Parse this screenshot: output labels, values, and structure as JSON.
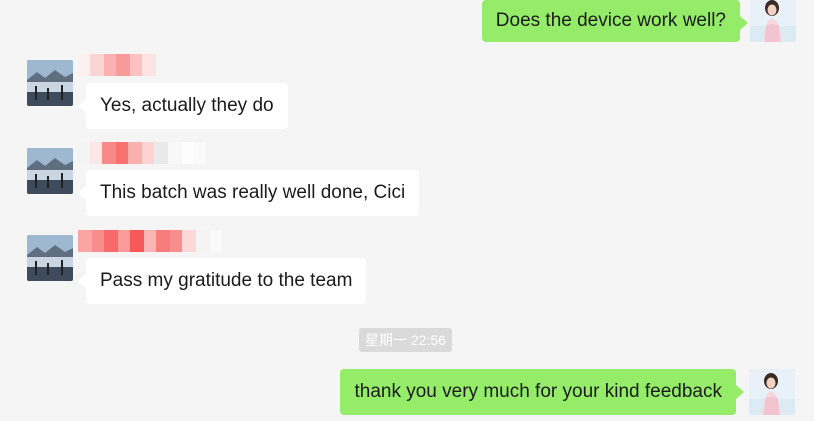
{
  "messages": [
    {
      "direction": "out",
      "text": "Does the device work well?",
      "avatar": "self-avatar"
    },
    {
      "direction": "in",
      "sender": "",
      "text": "Yes, actually they do",
      "avatar": "contact-avatar"
    },
    {
      "direction": "in",
      "sender": "",
      "text": "This batch was really well done, Cici",
      "avatar": "contact-avatar"
    },
    {
      "direction": "in",
      "sender": "",
      "text": "Pass my gratitude to the team",
      "avatar": "contact-avatar"
    },
    {
      "direction": "out",
      "text": "thank you very much for your kind feedback",
      "avatar": "self-avatar"
    }
  ],
  "timestamp": "星期一 22:56",
  "colors": {
    "background": "#f5f5f5",
    "incoming_bubble": "#ffffff",
    "outgoing_bubble": "#95ec69",
    "timestamp_bg": "#dadada"
  }
}
